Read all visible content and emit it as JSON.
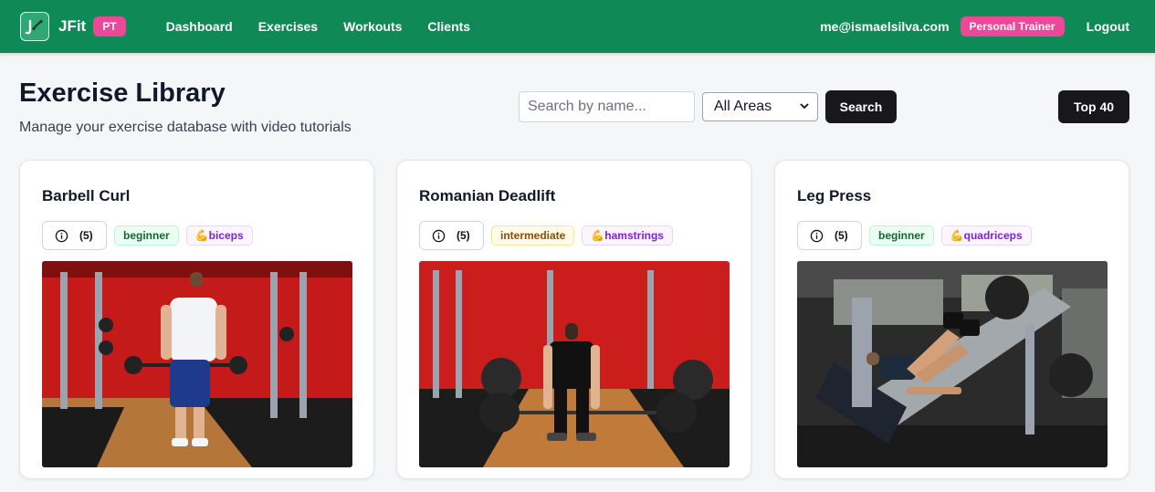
{
  "navbar": {
    "brand": "JFit",
    "brand_badge": "PT",
    "links": [
      "Dashboard",
      "Exercises",
      "Workouts",
      "Clients"
    ],
    "user_email": "me@ismaelsilva.com",
    "role_badge": "Personal Trainer",
    "logout_label": "Logout",
    "colors": {
      "background": "#0f8a57",
      "badge": "#ec4899"
    }
  },
  "header": {
    "title": "Exercise Library",
    "subtitle": "Manage your exercise database with video tutorials"
  },
  "filters": {
    "search_placeholder": "Search by name...",
    "search_value": "",
    "area_selected": "All Areas",
    "search_button": "Search",
    "top_button": "Top 40"
  },
  "exercises": [
    {
      "name": "Barbell Curl",
      "count": "(5)",
      "level": "beginner",
      "muscle": "💪biceps",
      "image": "barbell-curl-photo"
    },
    {
      "name": "Romanian Deadlift",
      "count": "(5)",
      "level": "intermediate",
      "muscle": "💪hamstrings",
      "image": "romanian-deadlift-photo"
    },
    {
      "name": "Leg Press",
      "count": "(5)",
      "level": "beginner",
      "muscle": "💪quadriceps",
      "image": "leg-press-photo"
    }
  ]
}
